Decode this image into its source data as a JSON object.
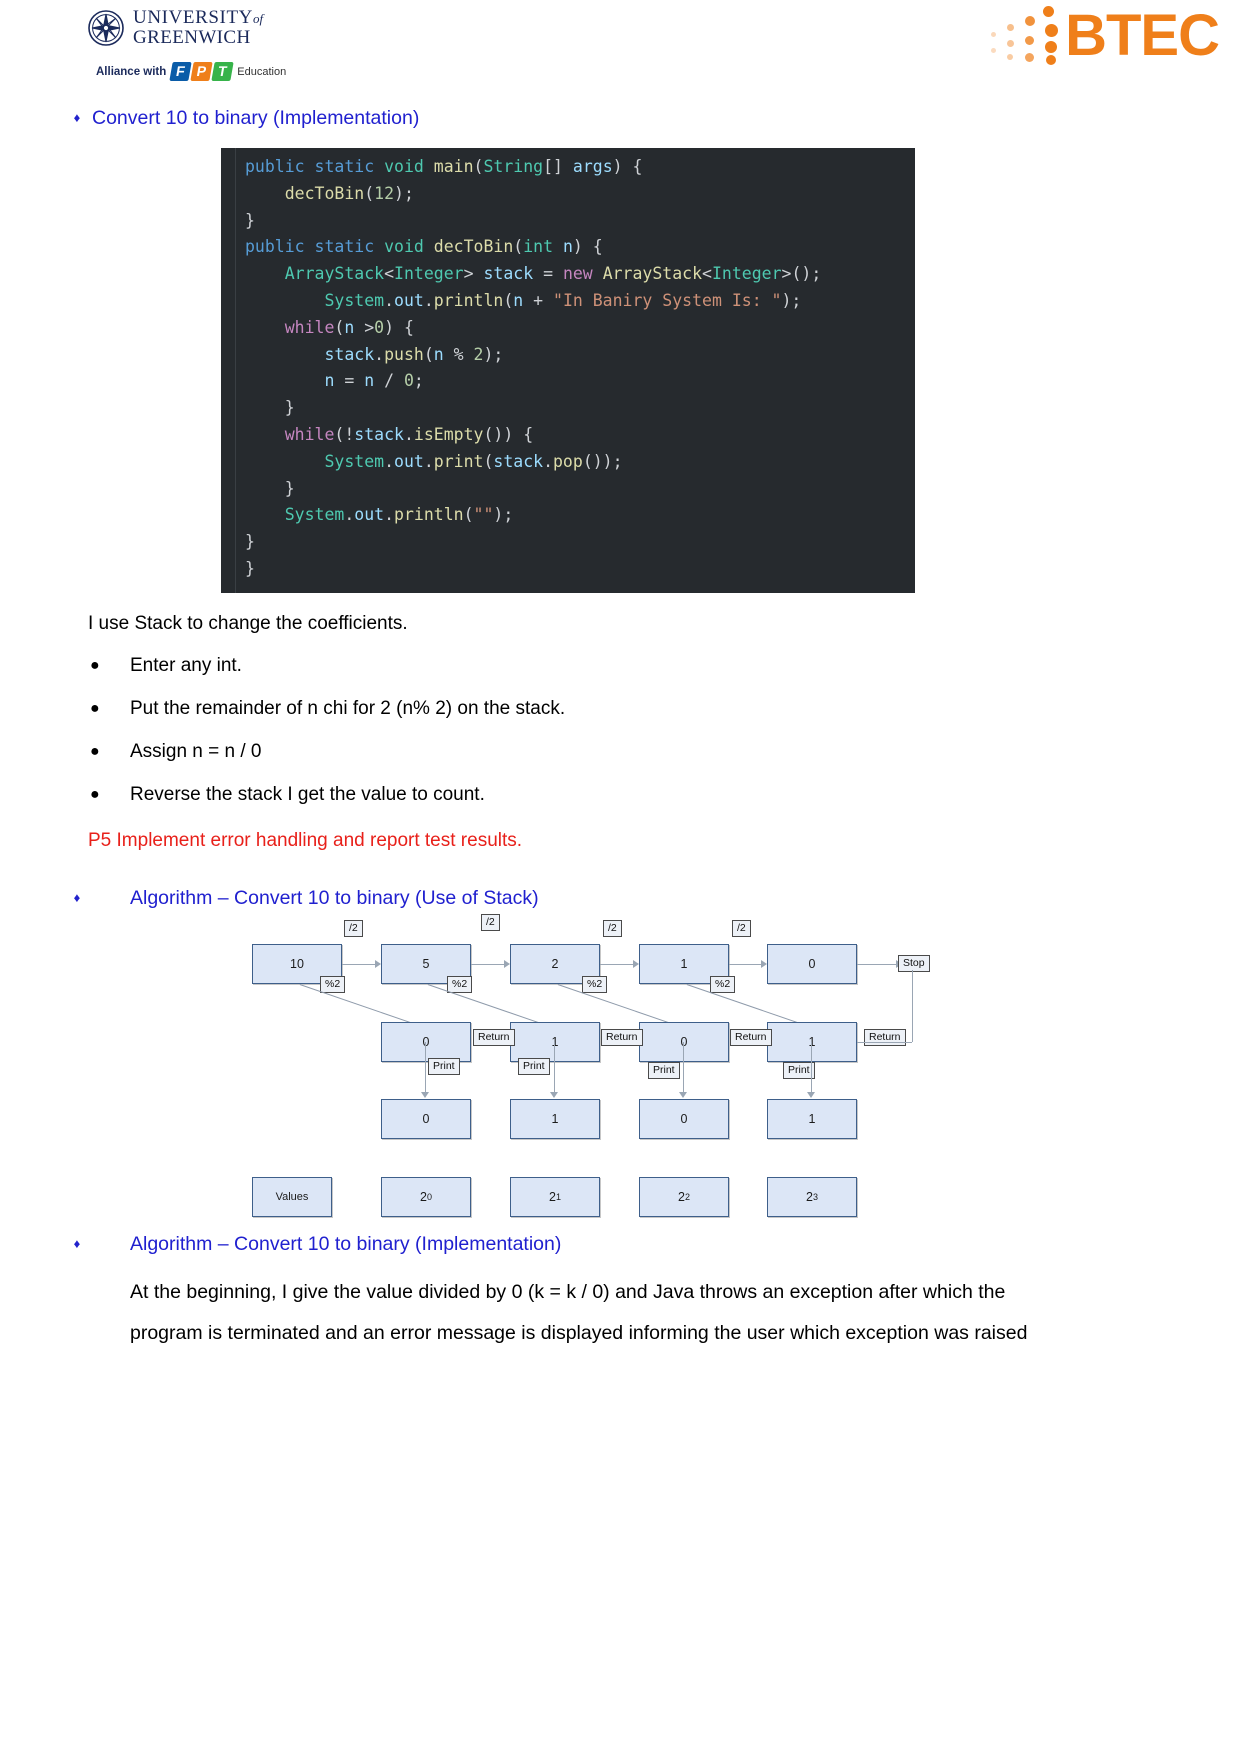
{
  "header": {
    "university_line1": "UNIVERSITY",
    "university_of": "of",
    "university_line2": "GREENWICH",
    "alliance_text": "Alliance with",
    "fpt_f": "F",
    "fpt_p": "P",
    "fpt_t": "T",
    "fpt_education": "Education",
    "btec_word": "BTEC"
  },
  "sections": {
    "heading_convert_impl": "Convert 10 to binary (Implementation)",
    "heading_algo_stack": "Algorithm – Convert 10 to binary (Use of Stack)",
    "heading_algo_impl": "Algorithm – Convert 10 to binary (Implementation)"
  },
  "diamond_glyph": "♦",
  "bullet_glyph": "●",
  "code": {
    "language": "java",
    "lines": [
      "public static void main(String[] args) {",
      "    decToBin(12);",
      "}",
      "public static void decToBin(int n) {",
      "    ArrayStack<Integer> stack = new ArrayStack<Integer>();",
      "        System.out.println(n + \"In Baniry System Is: \");",
      "    while(n >0) {",
      "        stack.push(n % 2);",
      "        n = n / 0;",
      "    }",
      "    while(!stack.isEmpty()) {",
      "        System.out.print(stack.pop());",
      "    }",
      "    System.out.println(\"\");",
      "}",
      "}"
    ]
  },
  "body": {
    "intro": "I use Stack to change the coefficients.",
    "bullets": [
      "Enter any int.",
      "Put the remainder of n chi for 2 (n% 2) on the stack.",
      "Assign n = n / 0",
      "Reverse the stack I get the value to count."
    ],
    "p5_line": "P5 Implement error handling and report test results.",
    "closing": "At the beginning, I give the value divided by 0 (k = k / 0) and Java throws an exception after which the program is terminated and an error message is displayed informing the user which exception was raised"
  },
  "diagram": {
    "row_divide": [
      {
        "value": "10"
      },
      {
        "value": "5"
      },
      {
        "value": "2"
      },
      {
        "value": "1"
      },
      {
        "value": "0"
      }
    ],
    "divide_labels": [
      "/2",
      "/2",
      "/2",
      "/2"
    ],
    "stop_label": "Stop",
    "mod_labels": [
      "%2",
      "%2",
      "%2",
      "%2"
    ],
    "row_remainder": [
      {
        "value": "0"
      },
      {
        "value": "1"
      },
      {
        "value": "0"
      },
      {
        "value": "1"
      }
    ],
    "return_labels": [
      "Return",
      "Return",
      "Return",
      "Return"
    ],
    "print_labels": [
      "Print",
      "Print",
      "Print",
      "Print"
    ],
    "row_printed": [
      {
        "value": "0"
      },
      {
        "value": "1"
      },
      {
        "value": "0"
      },
      {
        "value": "1"
      }
    ],
    "values_label": "Values",
    "row_values": [
      {
        "base": "2",
        "exp": "0"
      },
      {
        "base": "2",
        "exp": "1"
      },
      {
        "base": "2",
        "exp": "2"
      },
      {
        "base": "2",
        "exp": "3"
      }
    ]
  },
  "colors": {
    "heading_blue": "#2020cf",
    "alert_red": "#e8201a",
    "btec_orange": "#ef7f1a",
    "box_fill": "#dce6f6",
    "box_border": "#3e5f8a",
    "code_bg": "#262a2e"
  }
}
